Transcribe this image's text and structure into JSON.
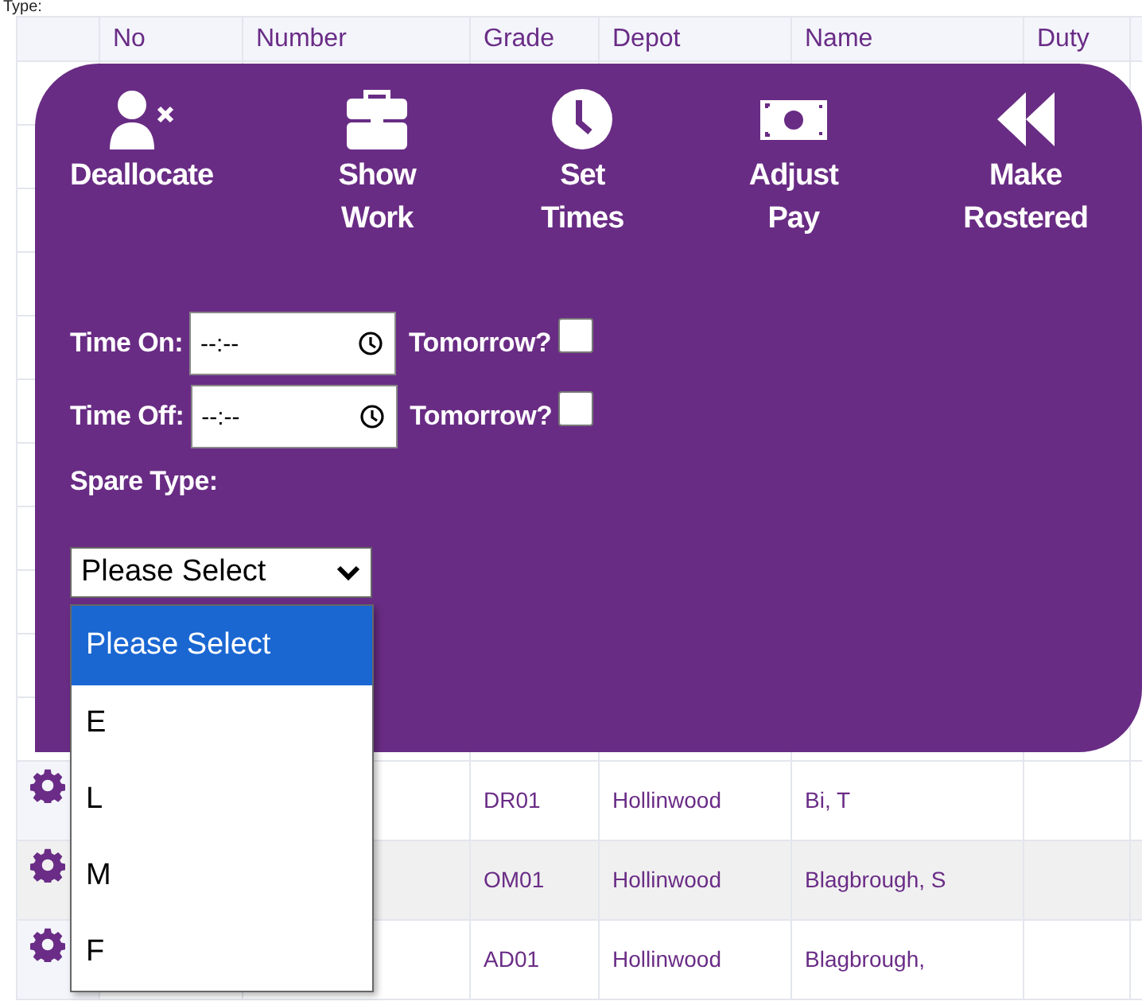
{
  "top_text": "Type:",
  "table": {
    "columns": [
      {
        "label": "No"
      },
      {
        "label": "Number"
      },
      {
        "label": "Grade"
      },
      {
        "label": "Depot"
      },
      {
        "label": "Name"
      },
      {
        "label": "Duty"
      }
    ],
    "rows": [
      {
        "grade": "DR01",
        "depot": "Hollinwood",
        "name": "Bi, T"
      },
      {
        "grade": "OM01",
        "depot": "Hollinwood",
        "name": "Blagbrough, S"
      },
      {
        "grade": "AD01",
        "depot": "Hollinwood",
        "name": "Blagbrough,"
      }
    ]
  },
  "actions": [
    {
      "kind": "user-remove",
      "label": "Deallocate"
    },
    {
      "kind": "briefcase",
      "label": "Show Work"
    },
    {
      "kind": "clock",
      "label": "Set Times"
    },
    {
      "kind": "money",
      "label": "Adjust Pay"
    },
    {
      "kind": "rewind",
      "label": "Make Rostered"
    }
  ],
  "times": [
    {
      "label": "Time On:",
      "placeholder": "--:--",
      "tomorrow_label": "Tomorrow?",
      "checked": false
    },
    {
      "label": "Time Off:",
      "placeholder": "--:--",
      "tomorrow_label": "Tomorrow?",
      "checked": false
    }
  ],
  "spare_type": {
    "label": "Spare Type:",
    "value": "Please Select",
    "options": [
      {
        "label": "Please Select",
        "selected": true
      },
      {
        "label": "E",
        "selected": false
      },
      {
        "label": "L",
        "selected": false
      },
      {
        "label": "M",
        "selected": false
      },
      {
        "label": "F",
        "selected": false
      }
    ]
  }
}
